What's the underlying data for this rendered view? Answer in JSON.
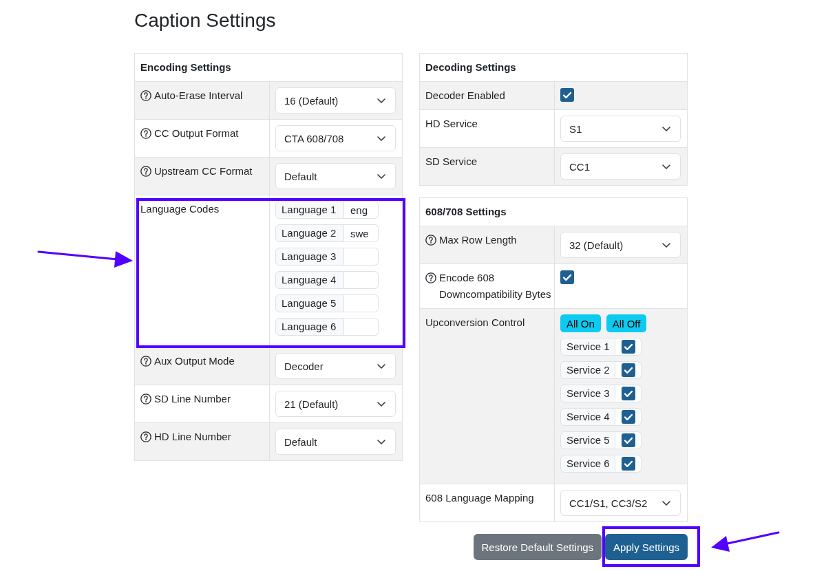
{
  "title": "Caption Settings",
  "columns": [
    {
      "panels": [
        {
          "title": "Encoding Settings",
          "rows": [
            {
              "kind": "select",
              "label": "Auto-Erase Interval",
              "help": true,
              "value": "16 (Default)",
              "highlighted": false
            },
            {
              "kind": "select",
              "label": "CC Output Format",
              "help": true,
              "value": "CTA 608/708",
              "highlighted": false
            },
            {
              "kind": "select",
              "label": "Upstream CC Format",
              "help": true,
              "value": "Default",
              "highlighted": false
            },
            {
              "kind": "language_codes",
              "label": "Language Codes",
              "help": false,
              "highlighted": true,
              "fields": [
                {
                  "label": "Language 1",
                  "value": "eng"
                },
                {
                  "label": "Language 2",
                  "value": "swe"
                },
                {
                  "label": "Language 3"
                },
                {
                  "label": "Language 4"
                },
                {
                  "label": "Language 5"
                },
                {
                  "label": "Language 6"
                }
              ]
            },
            {
              "kind": "select",
              "label": "Aux Output Mode",
              "help": true,
              "value": "Decoder",
              "highlighted": false
            },
            {
              "kind": "select",
              "label": "SD Line Number",
              "help": true,
              "value": "21 (Default)",
              "highlighted": false
            },
            {
              "kind": "select",
              "label": "HD Line Number",
              "help": true,
              "value": "Default",
              "highlighted": false
            }
          ]
        }
      ]
    },
    {
      "panels": [
        {
          "title": "Decoding Settings",
          "rows": [
            {
              "kind": "checkbox",
              "label": "Decoder Enabled",
              "help": false,
              "checked": true,
              "highlighted": false
            },
            {
              "kind": "select",
              "label": "HD Service",
              "help": false,
              "value": "S1",
              "highlighted": false
            },
            {
              "kind": "select",
              "label": "SD Service",
              "help": false,
              "value": "CC1",
              "highlighted": false
            }
          ]
        },
        {
          "title": "608/708 Settings",
          "rows": [
            {
              "kind": "select",
              "label": "Max Row Length",
              "help": true,
              "value": "32 (Default)",
              "highlighted": false
            },
            {
              "kind": "checkbox",
              "label": "Encode 608 Downcompatibility Bytes",
              "help": true,
              "checked": true,
              "highlighted": false
            },
            {
              "kind": "services",
              "label": "Upconversion Control",
              "help": false,
              "highlighted": false,
              "buttons": [
                "All On",
                "All Off"
              ],
              "services": [
                {
                  "label": "Service 1",
                  "checked": true
                },
                {
                  "label": "Service 2",
                  "checked": true
                },
                {
                  "label": "Service 3",
                  "checked": true
                },
                {
                  "label": "Service 4",
                  "checked": true
                },
                {
                  "label": "Service 5",
                  "checked": true
                },
                {
                  "label": "Service 6",
                  "checked": true
                }
              ]
            },
            {
              "kind": "select",
              "label": "608 Language Mapping",
              "help": false,
              "value": "CC1/S1, CC3/S2",
              "highlighted": false
            }
          ]
        }
      ]
    }
  ],
  "actions": [
    {
      "label": "Restore Default Settings",
      "kind": "secondary",
      "highlighted": false
    },
    {
      "label": "Apply Settings",
      "kind": "primary",
      "highlighted": true
    }
  ]
}
